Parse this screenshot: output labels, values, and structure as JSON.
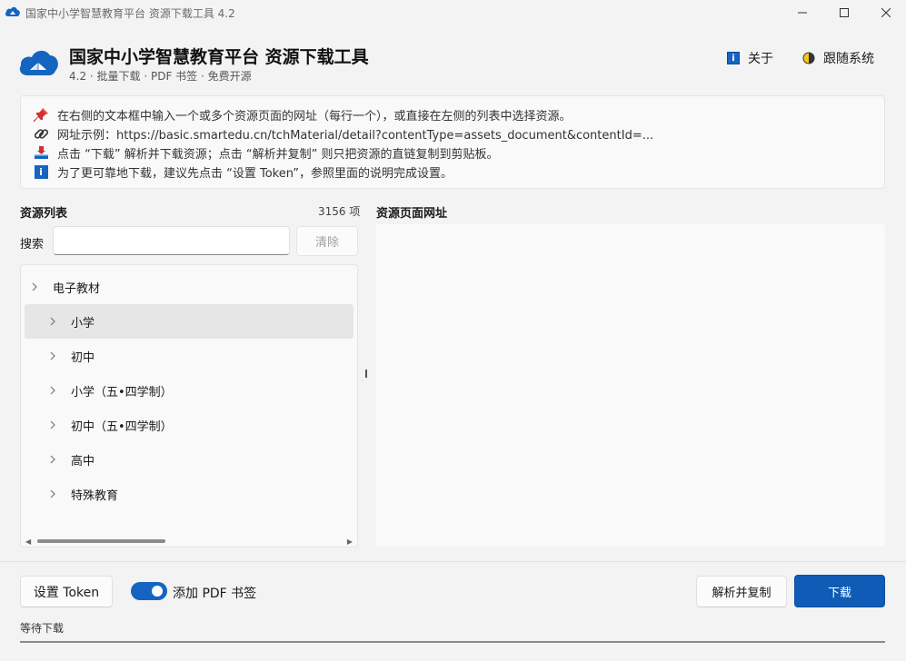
{
  "window": {
    "title": "国家中小学智慧教育平台 资源下载工具 4.2"
  },
  "header": {
    "app_title": "国家中小学智慧教育平台 资源下载工具",
    "subtitle": "4.2 · 批量下载 · PDF 书签 · 免费开源",
    "about_label": "关于",
    "theme_label": "跟随系统"
  },
  "info": {
    "lines": [
      "在右侧的文本框中输入一个或多个资源页面的网址（每行一个），或直接在左侧的列表中选择资源。",
      "网址示例：https://basic.smartedu.cn/tchMaterial/detail?contentType=assets_document&contentId=...",
      "点击 “下载” 解析并下载资源；点击 “解析并复制” 则只把资源的直链复制到剪贴板。",
      "为了更可靠地下载，建议先点击 “设置 Token”，参照里面的说明完成设置。"
    ]
  },
  "resources": {
    "label": "资源列表",
    "count": "3156 项",
    "search_label": "搜索",
    "search_value": "",
    "clear_label": "清除",
    "tree": {
      "root": "电子教材",
      "children": [
        "小学",
        "初中",
        "小学（五•四学制）",
        "初中（五•四学制）",
        "高中",
        "特殊教育"
      ],
      "selected_index": 0
    },
    "scroll_fraction": 0.0
  },
  "url_panel": {
    "label": "资源页面网址",
    "value": ""
  },
  "bottom": {
    "token_label": "设置 Token",
    "bookmark_toggle_label": "添加 PDF 书签",
    "bookmark_enabled": true,
    "parse_copy_label": "解析并复制",
    "download_label": "下载",
    "status": "等待下载",
    "progress": 0
  },
  "colors": {
    "accent": "#0f5bb5",
    "background": "#f3f3f3",
    "panel": "#f9f9f9"
  }
}
